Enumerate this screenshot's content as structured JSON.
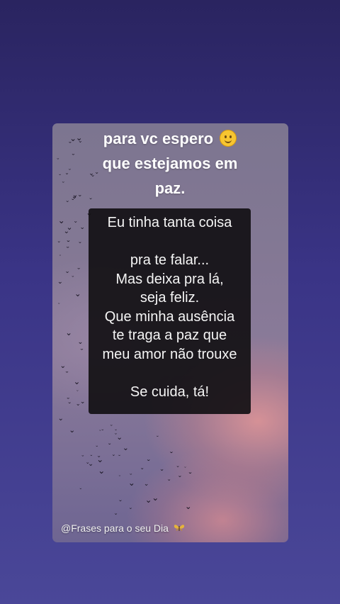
{
  "header": {
    "lines": [
      "para vc espero",
      "que estejamos em",
      "paz."
    ],
    "emoji": "slightly-smiling-face"
  },
  "quote": {
    "lines": [
      "Eu tinha tanta coisa",
      "",
      "pra te falar...",
      "Mas deixa pra lá,",
      "seja feliz.",
      "Que minha ausência",
      "te traga a paz que",
      "meu amor não trouxe",
      "",
      "Se cuida, tá!"
    ]
  },
  "watermark": {
    "text": "@Frases para o seu Dia",
    "icon": "butterfly-icon"
  },
  "colors": {
    "background": "#332d78",
    "quote_box": "#121014",
    "emoji": "#f7c531",
    "butterfly": "#e6b43a"
  }
}
